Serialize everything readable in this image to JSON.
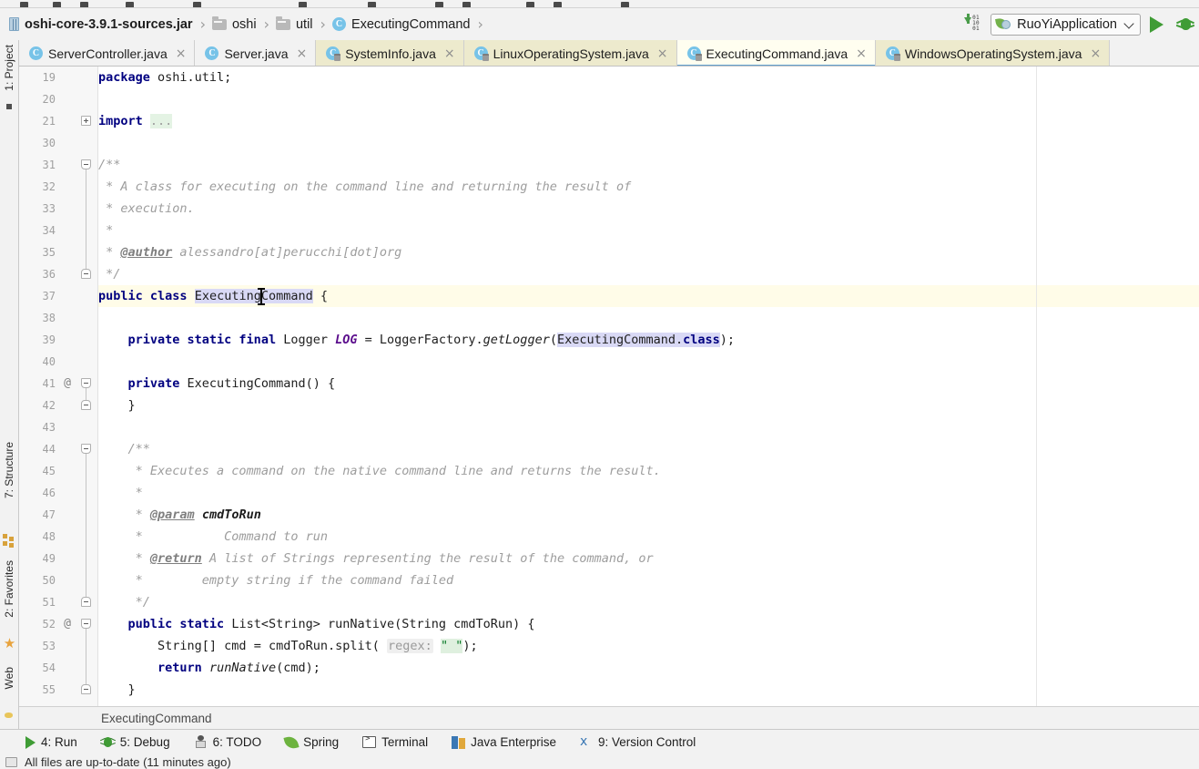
{
  "window": {
    "breadcrumb": [
      {
        "icon": "jar-icon",
        "label": "oshi-core-3.9.1-sources.jar",
        "bold": true
      },
      {
        "icon": "folder-icon",
        "label": "oshi",
        "bold": false
      },
      {
        "icon": "folder-icon",
        "label": "util",
        "bold": false
      },
      {
        "icon": "class-icon",
        "label": "ExecutingCommand",
        "bold": false
      }
    ],
    "separator": "›"
  },
  "toolbar": {
    "download_icon": "download-sources-icon",
    "download_digits": [
      "01",
      "10",
      "01"
    ],
    "run_config": {
      "label": "RuoYiApplication",
      "icon": "spring-boot-icon",
      "chevron": "chevron-down-icon"
    },
    "run_button": "run-icon",
    "debug_button": "debug-icon"
  },
  "left_tool_window": {
    "items": [
      {
        "label": "1: Project",
        "mnemonic": "1",
        "icon": "project-icon"
      },
      {
        "label": "7: Structure",
        "mnemonic": "7",
        "icon": "structure-icon"
      },
      {
        "label": "2: Favorites",
        "mnemonic": "2",
        "icon": "favorites-star-icon"
      },
      {
        "label": "Web",
        "mnemonic": "",
        "icon": "web-globe-icon"
      }
    ]
  },
  "editor_tabs": [
    {
      "label": "ServerController.java",
      "icon": "java-class-icon",
      "state": "plain",
      "close": "×"
    },
    {
      "label": "Server.java",
      "icon": "java-class-icon",
      "state": "plain",
      "close": "×"
    },
    {
      "label": "SystemInfo.java",
      "icon": "java-class-library-icon",
      "state": "lib",
      "close": "×"
    },
    {
      "label": "LinuxOperatingSystem.java",
      "icon": "java-class-library-icon",
      "state": "lib",
      "close": "×"
    },
    {
      "label": "ExecutingCommand.java",
      "icon": "java-class-library-icon",
      "state": "active",
      "close": "×"
    },
    {
      "label": "WindowsOperatingSystem.java",
      "icon": "java-class-library-icon",
      "state": "lib",
      "close": "×"
    }
  ],
  "editor": {
    "breadcrumb": "ExecutingCommand",
    "line_numbers": [
      19,
      20,
      21,
      30,
      31,
      32,
      33,
      34,
      35,
      36,
      37,
      38,
      39,
      40,
      41,
      42,
      43,
      44,
      45,
      46,
      47,
      48,
      49,
      50,
      51,
      52,
      53,
      54,
      55
    ],
    "highlighted_line": 37,
    "caret_line": 37,
    "annotations": {
      "41": "@",
      "52": "@"
    },
    "code": {
      "l19_kw": "package",
      "l19_rest": " oshi.util;",
      "l21_kw": "import",
      "l21_fold": "...",
      "l31": "/**",
      "l32": " * A class for executing on the command line and returning the result of",
      "l33": " * execution.",
      "l34": " *",
      "l35_star": " * ",
      "l35_tag": "@author",
      "l35_rest": " alessandro[at]perucchi[dot]org",
      "l36": " */",
      "l37_kw": "public class",
      "l37_name": "ExecutingCommand",
      "l37_brace": " {",
      "l39_kw": "private static final",
      "l39_type": " Logger ",
      "l39_field": "LOG",
      "l39_eq": " = LoggerFactory.",
      "l39_mth": "getLogger",
      "l39_p1": "(",
      "l39_arg": "ExecutingCommand.",
      "l39_cls": "class",
      "l39_end": ");",
      "l41_kw": "private",
      "l41_rest": " ExecutingCommand() {",
      "l42": "}",
      "l44": "/**",
      "l45": " * Executes a command on the native command line and returns the result.",
      "l46": " *",
      "l47_star": " * ",
      "l47_tag": "@param",
      "l47_rest": " cmdToRun",
      "l48": " *           Command to run",
      "l49_star": " * ",
      "l49_tag": "@return",
      "l49_rest": " A list of Strings representing the result of the command, or",
      "l50": " *        empty string if the command failed",
      "l51": " */",
      "l52_kw": "public static",
      "l52_rest": " List<String> runNative(String cmdToRun) {",
      "l53_a": "String[] cmd = cmdToRun.split(",
      "l53_hint": "regex:",
      "l53_str": "\" \"",
      "l53_b": ");",
      "l54_kw": "return",
      "l54_mth": " runNative",
      "l54_rest": "(cmd);",
      "l55": "}"
    }
  },
  "bottom_tool_windows": [
    {
      "label": "4: Run",
      "mnemonic": "4",
      "icon": "run-icon"
    },
    {
      "label": "5: Debug",
      "mnemonic": "5",
      "icon": "debug-icon"
    },
    {
      "label": "6: TODO",
      "mnemonic": "6",
      "icon": "todo-icon"
    },
    {
      "label": "Spring",
      "mnemonic": "",
      "icon": "spring-leaf-icon"
    },
    {
      "label": "Terminal",
      "mnemonic": "",
      "icon": "terminal-icon"
    },
    {
      "label": "Java Enterprise",
      "mnemonic": "",
      "icon": "java-enterprise-icon"
    },
    {
      "label": "9: Version Control",
      "mnemonic": "9",
      "icon": "version-control-icon"
    }
  ],
  "status_bar": {
    "message": "All files are up-to-date (11 minutes ago)",
    "icon": "vcs-status-icon"
  },
  "colors": {
    "accent_blue": "#60a0d0",
    "keyword": "#000080",
    "comment": "#9d9d9d",
    "field": "#5b0d8c",
    "string": "#0a7a28",
    "selection": "#d9d9f5",
    "line_highlight": "#fffce8",
    "tab_library": "#edeacd",
    "run_green": "#3f9c35"
  }
}
